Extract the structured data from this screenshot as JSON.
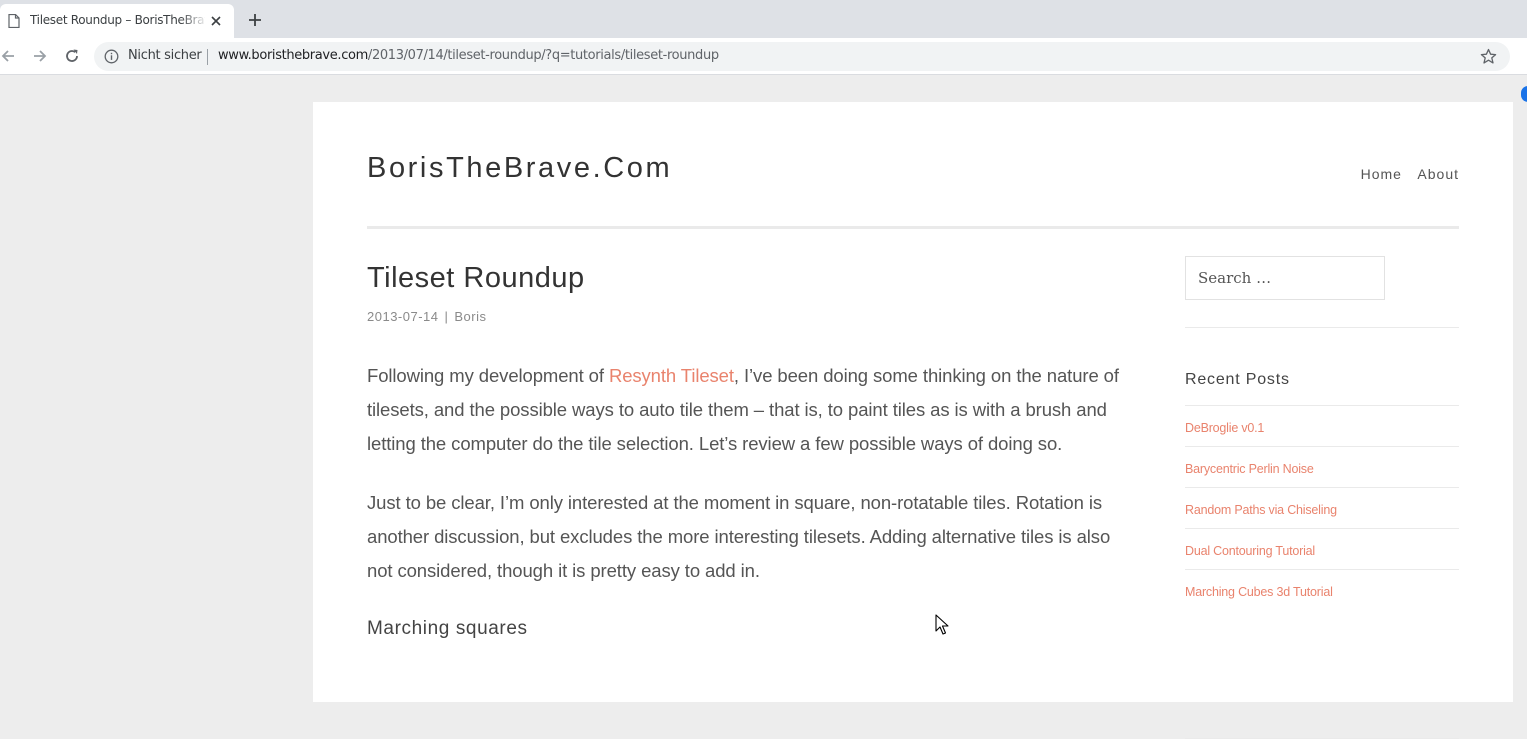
{
  "browser": {
    "tab_title": "Tileset Roundup – BorisTheBrave.Com",
    "security_label": "Nicht sicher",
    "url_host": "www.boristhebrave.com",
    "url_path": "/2013/07/14/tileset-roundup/?q=tutorials/tileset-roundup"
  },
  "site": {
    "title": "BorisTheBrave.Com",
    "nav": [
      "Home",
      "About"
    ]
  },
  "post": {
    "title": "Tileset Roundup",
    "date": "2013-07-14",
    "meta_divider": "|",
    "author": "Boris",
    "p1_before": "Following my development of ",
    "p1_link": "Resynth Tileset",
    "p1_after": ", I’ve been doing some thinking on the nature of tilesets, and the possible ways to auto tile them – that is, to paint tiles as is with a brush and letting the computer do the tile selection. Let’s review a few possible ways of doing so.",
    "p2": "Just to be clear, I’m only interested at the moment in square, non-rotatable tiles. Rotation is another discussion, but excludes the more interesting tilesets. Adding alternative tiles is also not considered, though it is pretty easy to add in.",
    "h2": "Marching squares"
  },
  "sidebar": {
    "search_placeholder": "Search …",
    "recent_title": "Recent Posts",
    "recent_posts": [
      "DeBroglie v0.1",
      "Barycentric Perlin Noise",
      "Random Paths via Chiseling",
      "Dual Contouring Tutorial",
      "Marching Cubes 3d Tutorial"
    ]
  },
  "colors": {
    "link": "#e9836d",
    "text": "#555555",
    "page_bg": "#ededed"
  }
}
